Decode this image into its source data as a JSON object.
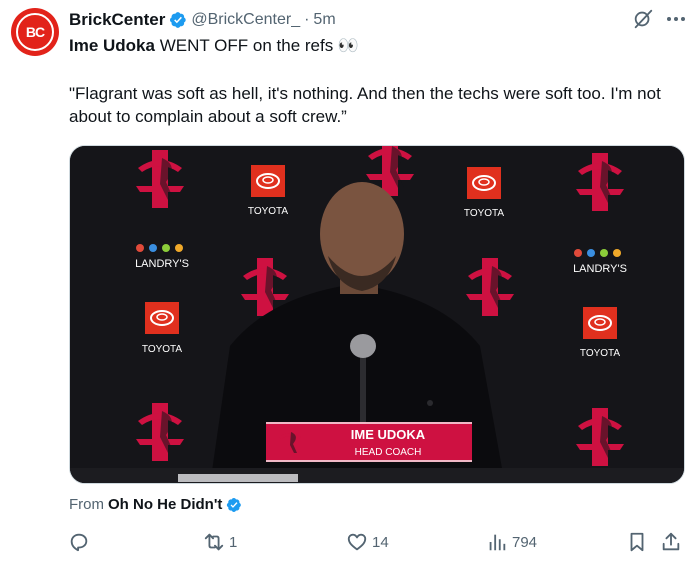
{
  "author": {
    "display_name": "BrickCenter",
    "handle": "@BrickCenter_",
    "separator": "·",
    "time": "5m",
    "avatar_text": "BC",
    "verified": true,
    "avatar_color": "#e2231a"
  },
  "post": {
    "headline_name": "Ime Udoka",
    "headline_rest": " WENT OFF on the refs 👀",
    "quote": "\"Flagrant was soft as hell, it's nothing. And then the techs were soft too. I'm not about to complain about a soft crew.”"
  },
  "media": {
    "sponsors": [
      "TOYOTA",
      "LANDRY'S"
    ],
    "lower_third_name": "IME UDOKA",
    "lower_third_title": "HEAD COACH",
    "backdrop_color": "#151519",
    "accent_color": "#ce1141"
  },
  "from": {
    "prefix": "From",
    "source": "Oh No He Didn't",
    "verified": true
  },
  "actions": {
    "reply_count": "",
    "repost_count": "1",
    "like_count": "14",
    "views_count": "794"
  },
  "icons": [
    "grok-icon",
    "more-icon",
    "reply-icon",
    "repost-icon",
    "like-icon",
    "views-icon",
    "bookmark-icon",
    "share-icon"
  ],
  "colors": {
    "verified_blue": "#1d9bf0",
    "muted_text": "#536471",
    "main_text": "#0f1419"
  }
}
